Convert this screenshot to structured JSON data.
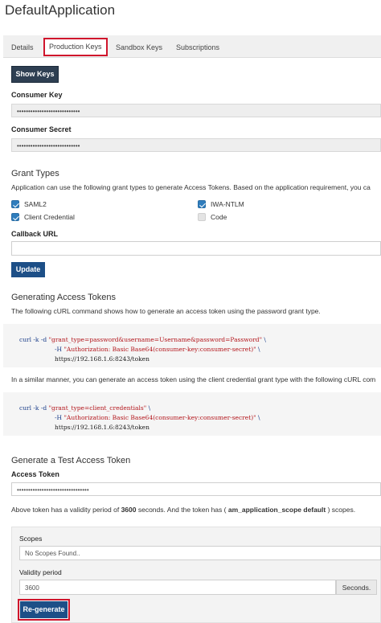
{
  "app": {
    "title": "DefaultApplication"
  },
  "tabs": [
    {
      "label": "Details",
      "active": false
    },
    {
      "label": "Production Keys",
      "active": true
    },
    {
      "label": "Sandbox Keys",
      "active": false
    },
    {
      "label": "Subscriptions",
      "active": false
    }
  ],
  "keys": {
    "show_keys_label": "Show Keys",
    "consumer_key_label": "Consumer Key",
    "consumer_key_value": "••••••••••••••••••••••••••••",
    "consumer_secret_label": "Consumer Secret",
    "consumer_secret_value": "••••••••••••••••••••••••••••"
  },
  "grant_types": {
    "title": "Grant Types",
    "description": "Application can use the following grant types to generate Access Tokens. Based on the application requirement, you ca",
    "options": [
      {
        "label": "SAML2",
        "checked": true
      },
      {
        "label": "IWA-NTLM",
        "checked": true
      },
      {
        "label": "Client Credential",
        "checked": true
      },
      {
        "label": "Code",
        "checked": false
      }
    ],
    "callback_label": "Callback URL",
    "callback_value": "",
    "update_label": "Update"
  },
  "generating": {
    "title": "Generating Access Tokens",
    "description": "The following cURL command shows how to generate an access token using the password grant type.",
    "curl1": {
      "l1_cmd": "curl -k -d ",
      "l1_str": "\"grant_type=password&username=Username&password=Password\"",
      "l1_tail": " \\",
      "l2_flag": "-H ",
      "l2_str": "\"Authorization: Basic Base64(consumer-key:consumer-secret)\"",
      "l2_tail": " \\",
      "l3": "https://192.168.1.6:8243/token"
    },
    "middle_text": "In a similar manner, you can generate an access token using the client credential grant type with the following cURL com",
    "curl2": {
      "l1_cmd": "curl -k -d ",
      "l1_str": "\"grant_type=client_credentials\"",
      "l1_tail": " \\",
      "l2_flag": "-H ",
      "l2_str": "\"Authorization: Basic Base64(consumer-key:consumer-secret)\"",
      "l2_tail": " \\",
      "l3": "https://192.168.1.6:8243/token"
    }
  },
  "test_token": {
    "title": "Generate a Test Access Token",
    "access_token_label": "Access Token",
    "access_token_value": "••••••••••••••••••••••••••••••••",
    "validity_pre": "Above token has a validity period of ",
    "validity_seconds": "3600",
    "validity_mid": " seconds. And the token has ( ",
    "validity_scope": "am_application_scope default",
    "validity_post": " ) scopes.",
    "scopes_label": "Scopes",
    "scopes_placeholder": "No Scopes Found..",
    "validity_period_label": "Validity period",
    "validity_period_value": "3600",
    "seconds_label": "Seconds.",
    "regenerate_label": "Re-generate"
  },
  "colors": {
    "highlight_red": "#d0152c",
    "primary_blue": "#1d4f87",
    "dark_button": "#2e3f52",
    "checkbox_blue": "#2f7dbd"
  }
}
